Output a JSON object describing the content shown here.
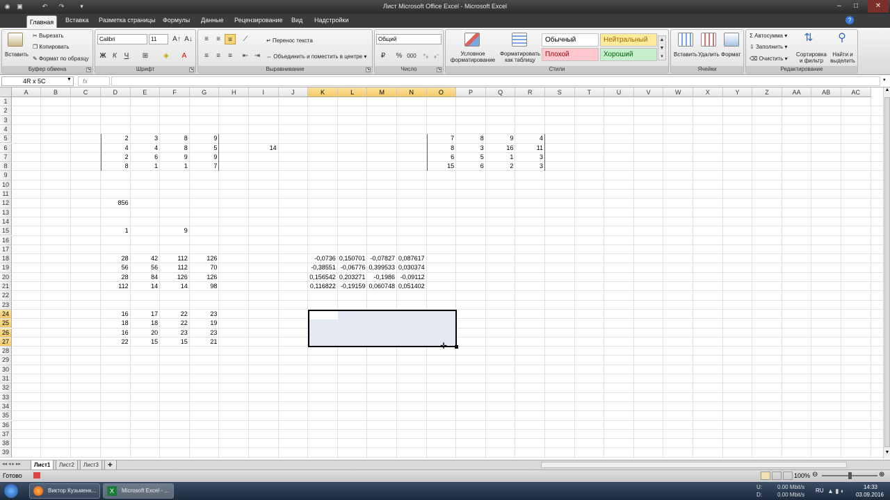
{
  "window": {
    "title": "Лист Microsoft Office Excel - Microsoft Excel",
    "quick_access": [
      "save-icon",
      "undo-icon",
      "redo-icon",
      "customize-icon"
    ],
    "controls": [
      "minimize-icon",
      "maximize-icon",
      "close-icon"
    ]
  },
  "tabs": [
    "Главная",
    "Вставка",
    "Разметка страницы",
    "Формулы",
    "Данные",
    "Рецензирование",
    "Вид",
    "Надстройки"
  ],
  "ribbon": {
    "clipboard": {
      "paste": "Вставить",
      "cut": "Вырезать",
      "copy": "Копировать",
      "format_painter": "Формат по образцу",
      "group": "Буфер обмена"
    },
    "font": {
      "name": "Calibri",
      "size": "11",
      "bold": "Ж",
      "italic": "К",
      "underline": "Ч",
      "group": "Шрифт"
    },
    "alignment": {
      "wrap": "Перенос текста",
      "merge": "Объединить и поместить в центре",
      "group": "Выравнивание"
    },
    "number": {
      "format": "Общий",
      "percent": "%",
      "thousands": "000",
      "group": "Число"
    },
    "styles": {
      "conditional": [
        "Условное",
        "форматирование"
      ],
      "as_table": [
        "Форматировать",
        "как таблицу"
      ],
      "items": [
        {
          "label": "Обычный",
          "color": "#000000",
          "bg": "#ffffff"
        },
        {
          "label": "Нейтральный",
          "color": "#9c6500",
          "bg": "#ffeb9c"
        },
        {
          "label": "Плохой",
          "color": "#9c0006",
          "bg": "#ffc7ce"
        },
        {
          "label": "Хороший",
          "color": "#006100",
          "bg": "#c6efce"
        }
      ],
      "group": "Стили"
    },
    "cells": {
      "insert": "Вставить",
      "delete": "Удалить",
      "format": "Формат",
      "group": "Ячейки"
    },
    "editing": {
      "autosum": "Автосумма",
      "fill": "Заполнить",
      "clear": "Очистить",
      "sort": [
        "Сортировка",
        "и фильтр"
      ],
      "find": [
        "Найти и",
        "выделить"
      ],
      "group": "Редактирование"
    }
  },
  "formula_bar": {
    "name_box": "4R x 5C",
    "fx": "fx",
    "formula": ""
  },
  "columns": [
    "A",
    "B",
    "C",
    "D",
    "E",
    "F",
    "G",
    "H",
    "I",
    "J",
    "K",
    "L",
    "M",
    "N",
    "O",
    "P",
    "Q",
    "R",
    "S",
    "T",
    "U",
    "V",
    "W",
    "X",
    "Y",
    "Z",
    "AA",
    "AB",
    "AC"
  ],
  "selected_columns": [
    "K",
    "L",
    "M",
    "N",
    "O"
  ],
  "selected_rows": [
    24,
    25,
    26,
    27
  ],
  "rows": [
    1,
    2,
    3,
    4,
    5,
    6,
    7,
    8,
    9,
    10,
    11,
    12,
    13,
    14,
    15,
    16,
    17,
    18,
    19,
    20,
    21,
    22,
    23,
    24,
    25,
    26,
    27,
    28,
    29,
    30,
    31,
    32,
    33,
    34,
    35,
    36,
    37,
    38,
    39
  ],
  "cells": [
    {
      "ref": "D5",
      "v": "2"
    },
    {
      "ref": "E5",
      "v": "3"
    },
    {
      "ref": "F5",
      "v": "8"
    },
    {
      "ref": "G5",
      "v": "9"
    },
    {
      "ref": "D6",
      "v": "4"
    },
    {
      "ref": "E6",
      "v": "4"
    },
    {
      "ref": "F6",
      "v": "8"
    },
    {
      "ref": "G6",
      "v": "5"
    },
    {
      "ref": "D7",
      "v": "2"
    },
    {
      "ref": "E7",
      "v": "6"
    },
    {
      "ref": "F7",
      "v": "9"
    },
    {
      "ref": "G7",
      "v": "9"
    },
    {
      "ref": "D8",
      "v": "8"
    },
    {
      "ref": "E8",
      "v": "1"
    },
    {
      "ref": "F8",
      "v": "1"
    },
    {
      "ref": "G8",
      "v": "7"
    },
    {
      "ref": "I6",
      "v": "14"
    },
    {
      "ref": "O5",
      "v": "7"
    },
    {
      "ref": "P5",
      "v": "8"
    },
    {
      "ref": "Q5",
      "v": "9"
    },
    {
      "ref": "R5",
      "v": "4"
    },
    {
      "ref": "O6",
      "v": "8"
    },
    {
      "ref": "P6",
      "v": "3"
    },
    {
      "ref": "Q6",
      "v": "16"
    },
    {
      "ref": "R6",
      "v": "11"
    },
    {
      "ref": "O7",
      "v": "6"
    },
    {
      "ref": "P7",
      "v": "5"
    },
    {
      "ref": "Q7",
      "v": "1"
    },
    {
      "ref": "R7",
      "v": "3"
    },
    {
      "ref": "O8",
      "v": "15"
    },
    {
      "ref": "P8",
      "v": "6"
    },
    {
      "ref": "Q8",
      "v": "2"
    },
    {
      "ref": "R8",
      "v": "3"
    },
    {
      "ref": "D12",
      "v": "856"
    },
    {
      "ref": "D15",
      "v": "1"
    },
    {
      "ref": "F15",
      "v": "9"
    },
    {
      "ref": "D18",
      "v": "28"
    },
    {
      "ref": "E18",
      "v": "42"
    },
    {
      "ref": "F18",
      "v": "112"
    },
    {
      "ref": "G18",
      "v": "126"
    },
    {
      "ref": "D19",
      "v": "56"
    },
    {
      "ref": "E19",
      "v": "56"
    },
    {
      "ref": "F19",
      "v": "112"
    },
    {
      "ref": "G19",
      "v": "70"
    },
    {
      "ref": "D20",
      "v": "28"
    },
    {
      "ref": "E20",
      "v": "84"
    },
    {
      "ref": "F20",
      "v": "126"
    },
    {
      "ref": "G20",
      "v": "126"
    },
    {
      "ref": "D21",
      "v": "112"
    },
    {
      "ref": "E21",
      "v": "14"
    },
    {
      "ref": "F21",
      "v": "14"
    },
    {
      "ref": "G21",
      "v": "98"
    },
    {
      "ref": "K18",
      "v": "-0,0736"
    },
    {
      "ref": "L18",
      "v": "0,150701"
    },
    {
      "ref": "M18",
      "v": "-0,07827"
    },
    {
      "ref": "N18",
      "v": "0,087617"
    },
    {
      "ref": "K19",
      "v": "-0,38551"
    },
    {
      "ref": "L19",
      "v": "-0,06776"
    },
    {
      "ref": "M19",
      "v": "0,399533"
    },
    {
      "ref": "N19",
      "v": "0,030374"
    },
    {
      "ref": "K20",
      "v": "0,156542"
    },
    {
      "ref": "L20",
      "v": "0,203271"
    },
    {
      "ref": "M20",
      "v": "-0,1986"
    },
    {
      "ref": "N20",
      "v": "-0,09112"
    },
    {
      "ref": "K21",
      "v": "0,116822"
    },
    {
      "ref": "L21",
      "v": "-0,19159"
    },
    {
      "ref": "M21",
      "v": "0,060748"
    },
    {
      "ref": "N21",
      "v": "0,051402"
    },
    {
      "ref": "D24",
      "v": "16"
    },
    {
      "ref": "E24",
      "v": "17"
    },
    {
      "ref": "F24",
      "v": "22"
    },
    {
      "ref": "G24",
      "v": "23"
    },
    {
      "ref": "D25",
      "v": "18"
    },
    {
      "ref": "E25",
      "v": "18"
    },
    {
      "ref": "F25",
      "v": "22"
    },
    {
      "ref": "G25",
      "v": "19"
    },
    {
      "ref": "D26",
      "v": "16"
    },
    {
      "ref": "E26",
      "v": "20"
    },
    {
      "ref": "F26",
      "v": "23"
    },
    {
      "ref": "G26",
      "v": "23"
    },
    {
      "ref": "D27",
      "v": "22"
    },
    {
      "ref": "E27",
      "v": "15"
    },
    {
      "ref": "F27",
      "v": "15"
    },
    {
      "ref": "G27",
      "v": "21"
    }
  ],
  "sheets": [
    "Лист1",
    "Лист2",
    "Лист3"
  ],
  "active_sheet": "Лист1",
  "status": {
    "ready": "Готово",
    "zoom": "100%"
  },
  "taskbar": {
    "items": [
      "Виктор Кузьменк...",
      "Microsoft Excel - ..."
    ],
    "net_up_label": "U:",
    "net_down_label": "D:",
    "net_up": "0.00 Mbit/s",
    "net_down": "0.00 Mbit/s",
    "lang": "RU",
    "time": "14:33",
    "date": "03.09.2016"
  },
  "colors": {
    "selection_fill": "#e3e8f3",
    "header_selected": "#f5c965",
    "taskbar": "#1c2a3c"
  }
}
